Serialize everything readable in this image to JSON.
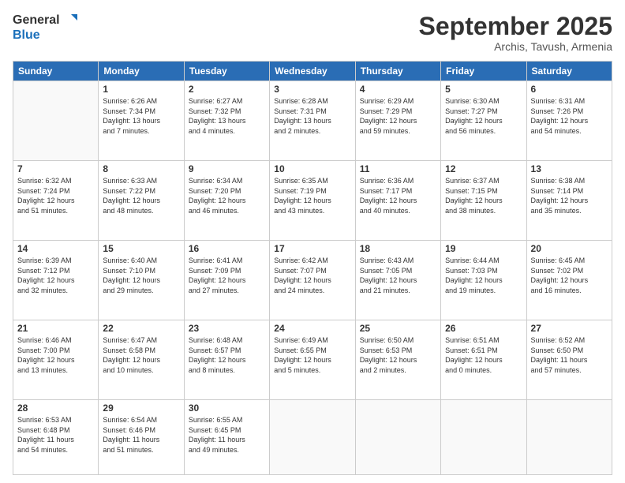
{
  "logo": {
    "line1": "General",
    "line2": "Blue"
  },
  "header": {
    "month": "September 2025",
    "location": "Archis, Tavush, Armenia"
  },
  "weekdays": [
    "Sunday",
    "Monday",
    "Tuesday",
    "Wednesday",
    "Thursday",
    "Friday",
    "Saturday"
  ],
  "rows": [
    [
      {
        "day": null,
        "info": null
      },
      {
        "day": "1",
        "info": "Sunrise: 6:26 AM\nSunset: 7:34 PM\nDaylight: 13 hours\nand 7 minutes."
      },
      {
        "day": "2",
        "info": "Sunrise: 6:27 AM\nSunset: 7:32 PM\nDaylight: 13 hours\nand 4 minutes."
      },
      {
        "day": "3",
        "info": "Sunrise: 6:28 AM\nSunset: 7:31 PM\nDaylight: 13 hours\nand 2 minutes."
      },
      {
        "day": "4",
        "info": "Sunrise: 6:29 AM\nSunset: 7:29 PM\nDaylight: 12 hours\nand 59 minutes."
      },
      {
        "day": "5",
        "info": "Sunrise: 6:30 AM\nSunset: 7:27 PM\nDaylight: 12 hours\nand 56 minutes."
      },
      {
        "day": "6",
        "info": "Sunrise: 6:31 AM\nSunset: 7:26 PM\nDaylight: 12 hours\nand 54 minutes."
      }
    ],
    [
      {
        "day": "7",
        "info": "Sunrise: 6:32 AM\nSunset: 7:24 PM\nDaylight: 12 hours\nand 51 minutes."
      },
      {
        "day": "8",
        "info": "Sunrise: 6:33 AM\nSunset: 7:22 PM\nDaylight: 12 hours\nand 48 minutes."
      },
      {
        "day": "9",
        "info": "Sunrise: 6:34 AM\nSunset: 7:20 PM\nDaylight: 12 hours\nand 46 minutes."
      },
      {
        "day": "10",
        "info": "Sunrise: 6:35 AM\nSunset: 7:19 PM\nDaylight: 12 hours\nand 43 minutes."
      },
      {
        "day": "11",
        "info": "Sunrise: 6:36 AM\nSunset: 7:17 PM\nDaylight: 12 hours\nand 40 minutes."
      },
      {
        "day": "12",
        "info": "Sunrise: 6:37 AM\nSunset: 7:15 PM\nDaylight: 12 hours\nand 38 minutes."
      },
      {
        "day": "13",
        "info": "Sunrise: 6:38 AM\nSunset: 7:14 PM\nDaylight: 12 hours\nand 35 minutes."
      }
    ],
    [
      {
        "day": "14",
        "info": "Sunrise: 6:39 AM\nSunset: 7:12 PM\nDaylight: 12 hours\nand 32 minutes."
      },
      {
        "day": "15",
        "info": "Sunrise: 6:40 AM\nSunset: 7:10 PM\nDaylight: 12 hours\nand 29 minutes."
      },
      {
        "day": "16",
        "info": "Sunrise: 6:41 AM\nSunset: 7:09 PM\nDaylight: 12 hours\nand 27 minutes."
      },
      {
        "day": "17",
        "info": "Sunrise: 6:42 AM\nSunset: 7:07 PM\nDaylight: 12 hours\nand 24 minutes."
      },
      {
        "day": "18",
        "info": "Sunrise: 6:43 AM\nSunset: 7:05 PM\nDaylight: 12 hours\nand 21 minutes."
      },
      {
        "day": "19",
        "info": "Sunrise: 6:44 AM\nSunset: 7:03 PM\nDaylight: 12 hours\nand 19 minutes."
      },
      {
        "day": "20",
        "info": "Sunrise: 6:45 AM\nSunset: 7:02 PM\nDaylight: 12 hours\nand 16 minutes."
      }
    ],
    [
      {
        "day": "21",
        "info": "Sunrise: 6:46 AM\nSunset: 7:00 PM\nDaylight: 12 hours\nand 13 minutes."
      },
      {
        "day": "22",
        "info": "Sunrise: 6:47 AM\nSunset: 6:58 PM\nDaylight: 12 hours\nand 10 minutes."
      },
      {
        "day": "23",
        "info": "Sunrise: 6:48 AM\nSunset: 6:57 PM\nDaylight: 12 hours\nand 8 minutes."
      },
      {
        "day": "24",
        "info": "Sunrise: 6:49 AM\nSunset: 6:55 PM\nDaylight: 12 hours\nand 5 minutes."
      },
      {
        "day": "25",
        "info": "Sunrise: 6:50 AM\nSunset: 6:53 PM\nDaylight: 12 hours\nand 2 minutes."
      },
      {
        "day": "26",
        "info": "Sunrise: 6:51 AM\nSunset: 6:51 PM\nDaylight: 12 hours\nand 0 minutes."
      },
      {
        "day": "27",
        "info": "Sunrise: 6:52 AM\nSunset: 6:50 PM\nDaylight: 11 hours\nand 57 minutes."
      }
    ],
    [
      {
        "day": "28",
        "info": "Sunrise: 6:53 AM\nSunset: 6:48 PM\nDaylight: 11 hours\nand 54 minutes."
      },
      {
        "day": "29",
        "info": "Sunrise: 6:54 AM\nSunset: 6:46 PM\nDaylight: 11 hours\nand 51 minutes."
      },
      {
        "day": "30",
        "info": "Sunrise: 6:55 AM\nSunset: 6:45 PM\nDaylight: 11 hours\nand 49 minutes."
      },
      {
        "day": null,
        "info": null
      },
      {
        "day": null,
        "info": null
      },
      {
        "day": null,
        "info": null
      },
      {
        "day": null,
        "info": null
      }
    ]
  ]
}
